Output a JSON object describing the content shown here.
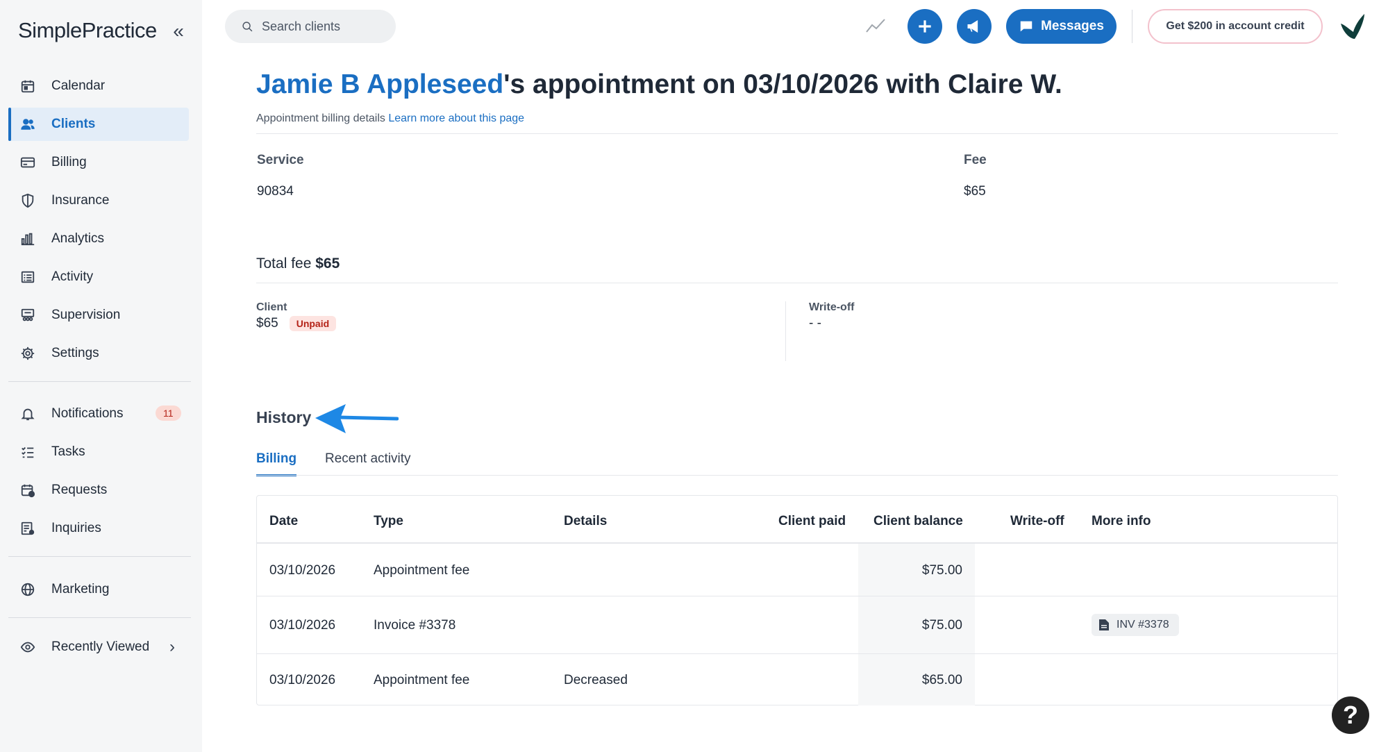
{
  "brand": {
    "logo_text": "SimplePractice",
    "collapse_glyph": "«"
  },
  "sidebar": {
    "items": [
      {
        "label": "Calendar",
        "icon": "calendar-icon"
      },
      {
        "label": "Clients",
        "icon": "users-icon",
        "active": true
      },
      {
        "label": "Billing",
        "icon": "credit-card-icon"
      },
      {
        "label": "Insurance",
        "icon": "shield-icon"
      },
      {
        "label": "Analytics",
        "icon": "bar-chart-icon"
      },
      {
        "label": "Activity",
        "icon": "list-icon"
      },
      {
        "label": "Supervision",
        "icon": "supervision-icon"
      },
      {
        "label": "Settings",
        "icon": "gear-icon"
      }
    ],
    "secondary": [
      {
        "label": "Notifications",
        "icon": "bell-icon",
        "count": "11"
      },
      {
        "label": "Tasks",
        "icon": "tasks-icon"
      },
      {
        "label": "Requests",
        "icon": "calendar-request-icon"
      },
      {
        "label": "Inquiries",
        "icon": "inquiries-icon"
      }
    ],
    "marketing": {
      "label": "Marketing",
      "icon": "globe-icon"
    },
    "recently_viewed": {
      "label": "Recently Viewed",
      "icon": "eye-icon",
      "chevron": "›"
    }
  },
  "topbar": {
    "search_placeholder": "Search clients",
    "messages_label": "Messages",
    "credit_label": "Get $200 in account credit"
  },
  "page": {
    "client_name": "Jamie B Appleseed",
    "title_rest": "'s appointment on 03/10/2026 with Claire W.",
    "subtitle": "Appointment billing details",
    "learn_more": "Learn more about this page",
    "service_header": "Service",
    "service_value": "90834",
    "fee_header": "Fee",
    "fee_value": "$65",
    "total_label": "Total fee",
    "total_value": "$65",
    "client_label": "Client",
    "client_value": "$65",
    "status": "Unpaid",
    "writeoff_label": "Write-off",
    "writeoff_value": "- -"
  },
  "history": {
    "title": "History",
    "tabs": [
      {
        "label": "Billing",
        "active": true
      },
      {
        "label": "Recent activity",
        "active": false
      }
    ],
    "columns": [
      "Date",
      "Type",
      "Details",
      "Client paid",
      "Client balance",
      "Write-off",
      "More info"
    ],
    "rows": [
      {
        "date": "03/10/2026",
        "type": "Appointment fee",
        "details": "",
        "client_paid": "",
        "client_balance": "$75.00",
        "write_off": "",
        "more_info": ""
      },
      {
        "date": "03/10/2026",
        "type": "Invoice #3378",
        "details": "",
        "client_paid": "",
        "client_balance": "$75.00",
        "write_off": "",
        "more_info": "INV #3378"
      },
      {
        "date": "03/10/2026",
        "type": "Appointment fee",
        "details": "Decreased",
        "client_paid": "",
        "client_balance": "$65.00",
        "write_off": "",
        "more_info": ""
      }
    ]
  },
  "help_glyph": "?",
  "colors": {
    "accent": "#1a6ec2",
    "sidebar_bg": "#f5f6f7",
    "unpaid_bg": "#fde4e1",
    "unpaid_text": "#b42318"
  }
}
